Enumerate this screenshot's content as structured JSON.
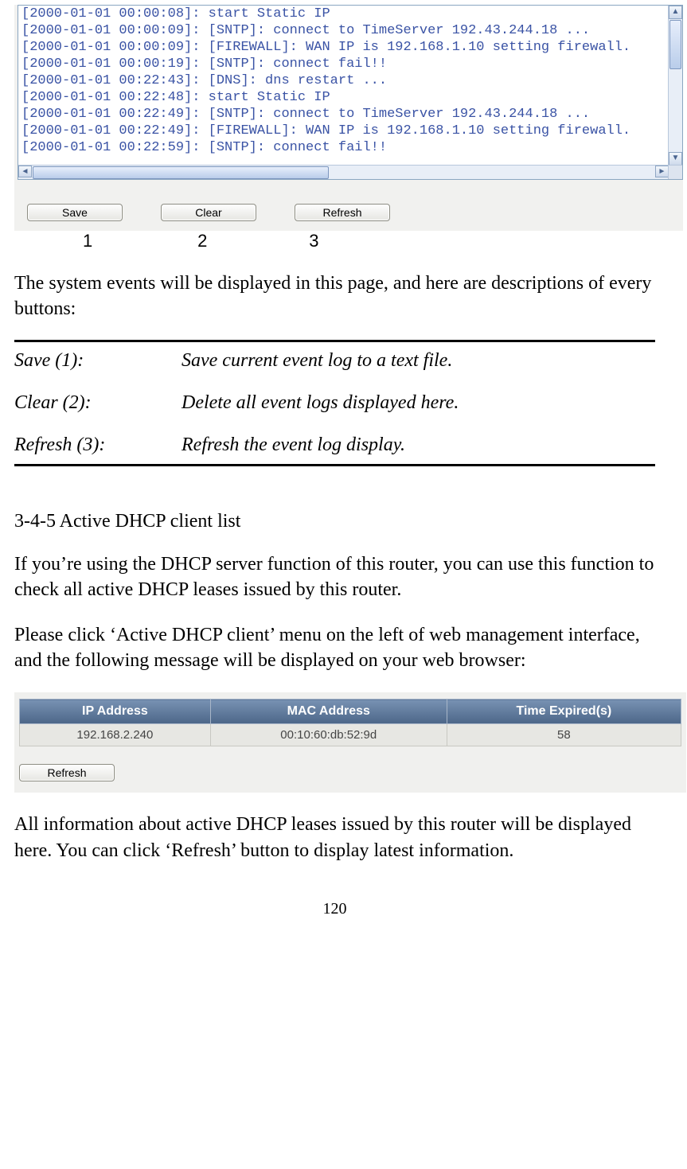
{
  "event_log_panel": {
    "lines": [
      "[2000-01-01 00:00:08]: start Static IP",
      "[2000-01-01 00:00:09]: [SNTP]: connect to TimeServer 192.43.244.18 ...",
      "[2000-01-01 00:00:09]: [FIREWALL]: WAN IP is 192.168.1.10 setting firewall.",
      "[2000-01-01 00:00:19]: [SNTP]: connect fail!!",
      "[2000-01-01 00:22:43]: [DNS]: dns restart ...",
      "[2000-01-01 00:22:48]: start Static IP",
      "[2000-01-01 00:22:49]: [SNTP]: connect to TimeServer 192.43.244.18 ...",
      "[2000-01-01 00:22:49]: [FIREWALL]: WAN IP is 192.168.1.10 setting firewall.",
      "[2000-01-01 00:22:59]: [SNTP]: connect fail!!"
    ],
    "buttons": {
      "save": "Save",
      "clear": "Clear",
      "refresh": "Refresh"
    },
    "numbers": {
      "n1": "1",
      "n2": "2",
      "n3": "3"
    }
  },
  "intro_text": "The system events will be displayed in this page, and here are descriptions of every buttons:",
  "definitions": [
    {
      "label": "Save (1):",
      "desc": "Save current event log to a text file."
    },
    {
      "label": "Clear (2):",
      "desc": "Delete all event logs displayed here."
    },
    {
      "label": "Refresh (3):",
      "desc": "Refresh the event log display."
    }
  ],
  "section_title": "3-4-5 Active DHCP client list",
  "dhcp_intro_1": "If you’re using the DHCP server function of this router, you can use this function to check all active DHCP leases issued by this router.",
  "dhcp_intro_2": "Please click ‘Active DHCP client’ menu on the left of web management interface, and the following message will be displayed on your web browser:",
  "dhcp_table": {
    "headers": [
      "IP Address",
      "MAC Address",
      "Time Expired(s)"
    ],
    "rows": [
      [
        "192.168.2.240",
        "00:10:60:db:52:9d",
        "58"
      ]
    ],
    "refresh_label": "Refresh"
  },
  "dhcp_outro": "All information about active DHCP leases issued by this router will be displayed here. You can click ‘Refresh’ button to display latest information.",
  "page_number": "120"
}
